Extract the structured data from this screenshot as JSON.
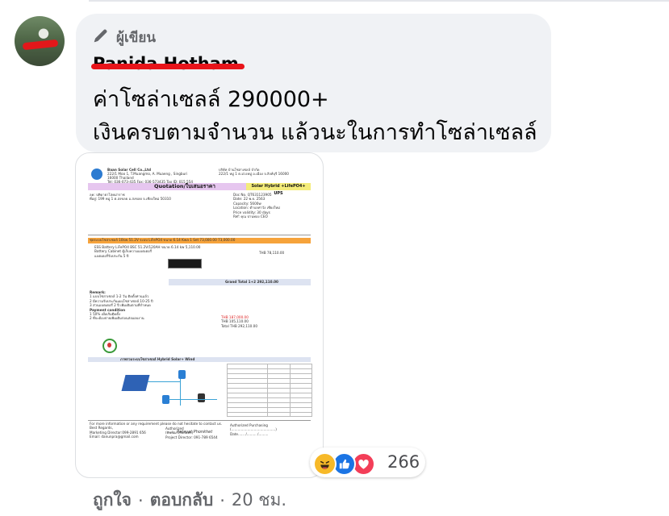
{
  "comment": {
    "badge": "ผู้เขียน",
    "author": "Panida Hotham",
    "message_lines": [
      "ค่าโซล่าเซลล์ 290000+",
      "เงินครบตามจำนวน แล้วนะในการทำโซล่าเซลล์"
    ]
  },
  "attachment": {
    "company_left": [
      "Baan Solar Cell Co.,Ltd",
      "222/1 Moo 1, T.Muangmo, A. Muaeng , Singburi 16000 Thailand",
      "Tel: 036-073-435  Fax: 036-573435  Tax ID: 015 554 006 1191"
    ],
    "company_right": [
      "บริษัท บ้านโซล่าเซลล์ จำกัด",
      "222/1 หมู่ 1 ต.ม่วงหมู่ อ.เมือง จ.สิงห์บุรี 16000"
    ],
    "title": "Quotation/ใบเสนอราคา",
    "title_right": "Solar Hybrid +LifePO4+ UPS",
    "customer_lines": [
      "ลค:   ปทิดายาโสคม่าราช",
      "ที่อยู่: 199 หมู่ 1 ต.สงขลย อ.สงขลย จ.เชียงใหม่ 50310"
    ],
    "info_lines": [
      "Doc No.      QT631123905",
      "Date:           22 พ.ย. 2563",
      "Capacity:      5600w",
      "Location:      ตำบลท่าวัง เชียงใหม่",
      "Price validity:  30 days",
      "Ref:               คุณ ปานทอง CEO"
    ],
    "item_row": "ชุดระบบโซล่าเซลล์ 10kw  51.2V ระบบ LiFePO4  ขนาด 6.14 Kwa   1   Set   73,000.00   73,000.00",
    "item_lines": [
      "ESS Battery LiFePO4  BSC  51.2V/120AH  ขนาด 6.14 kw    5,110.00",
      "Battery Cabinet  ตู้เก็บความแบตเตอรี่",
      "แบตเตอรี่รับประกัน 5 ปี"
    ],
    "thb_total": "THB  78,110.00",
    "grand_total": "Grand Total 1+2      292,110.00",
    "remarks": [
      "Remark:",
      "1   แบบโซล่าเซลล์ 1-2 วัน ติดตั้งท่านแล้ว",
      "2   มีความรับประกันแผงโซล่าเซลล์ 10-25 ปี",
      "3   ส่วนแบตเตอรี่ 2 ปี เพิ่มเติมตามที่กำหนด",
      "Payment condition",
      "1   50%  เมื่อเริ่มติดตั้ง",
      "2   ที่จะต้องจ่ายเพิ่มเติมก่อนส่งมอบงาน"
    ],
    "payment_lines": [
      "THB   187,000.00",
      "THB   105,110.00",
      "Total    THB   292,110.00"
    ],
    "section_title": "ภาพรวมระบบโซล่าเซลล์ Hybrid Solar+ Wind",
    "footer_lines": [
      "For more information or any requirement please do not hesitate to contact us.",
      "Best Regards,",
      "Marketing Director:099-2891 656",
      "Email: danunpra@gmail.com"
    ],
    "signature": "Patavat Phonkhet",
    "sign_block": [
      "Authorized",
      "(พิพพัฒ  สุริยสมพร)",
      "Project Director: 091-789 6544"
    ],
    "accept_block": [
      "Authorized  Purchasing",
      "(.........................................)",
      "Date...... /......... /........."
    ]
  },
  "reactions": {
    "types": [
      "haha",
      "like",
      "love"
    ],
    "count": "266",
    "colors": {
      "haha": "#f7b928",
      "like": "#1b74e4",
      "love": "#f33e58"
    }
  },
  "actions": {
    "like": "ถูกใจ",
    "reply": "ตอบกลับ",
    "time": "20 ชม."
  }
}
